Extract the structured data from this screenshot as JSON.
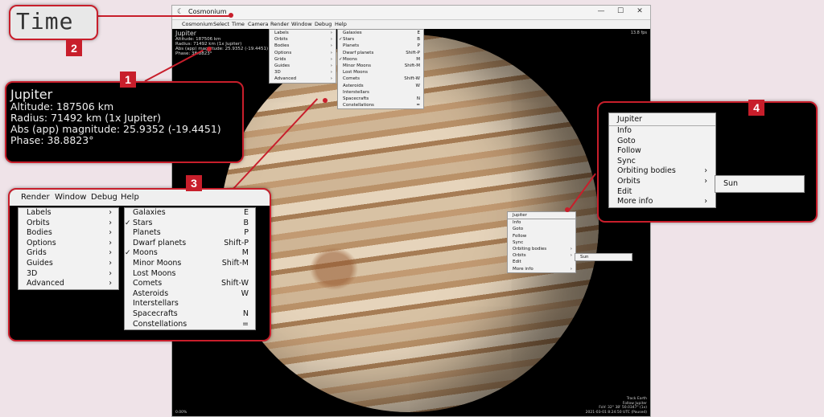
{
  "window": {
    "title": "Cosmonium",
    "app_icon": "moon-icon",
    "controls": {
      "minimize": "—",
      "maximize": "☐",
      "close": "✕"
    }
  },
  "menubar": [
    "Cosmonium",
    "Select",
    "Time",
    "Camera",
    "Render",
    "Window",
    "Debug",
    "Help"
  ],
  "hud": {
    "name": "Jupiter",
    "altitude": "Altitude: 187506 km",
    "radius": "Radius: 71492 km (1x Jupiter)",
    "magnitude": "Abs (app) magnitude: 25.9352 (-19.4451)",
    "phase": "Phase: 38.8823°",
    "fps": "13.8 fps",
    "bottom_left": "0.00%",
    "bottom_right": [
      "Track Earth",
      "Follow Jupiter",
      "FoV: 32° 38' 50.0347\" (1x)",
      "2021-03-01 8:24:50 UTC (Paused)"
    ]
  },
  "render_menu": {
    "items": [
      {
        "label": "Labels",
        "arrow": "›"
      },
      {
        "label": "Orbits",
        "arrow": "›"
      },
      {
        "label": "Bodies",
        "arrow": "›"
      },
      {
        "label": "Options",
        "arrow": "›"
      },
      {
        "label": "Grids",
        "arrow": "›"
      },
      {
        "label": "Guides",
        "arrow": "›"
      },
      {
        "label": "3D",
        "arrow": "›"
      },
      {
        "label": "Advanced",
        "arrow": "›"
      }
    ]
  },
  "labels_submenu": {
    "items": [
      {
        "label": "Galaxies",
        "key": "E",
        "check": ""
      },
      {
        "label": "Stars",
        "key": "B",
        "check": "✓"
      },
      {
        "label": "Planets",
        "key": "P",
        "check": ""
      },
      {
        "label": "Dwarf planets",
        "key": "Shift-P",
        "check": ""
      },
      {
        "label": "Moons",
        "key": "M",
        "check": "✓"
      },
      {
        "label": "Minor Moons",
        "key": "Shift-M",
        "check": ""
      },
      {
        "label": "Lost Moons",
        "key": "",
        "check": ""
      },
      {
        "label": "Comets",
        "key": "Shift-W",
        "check": ""
      },
      {
        "label": "Asteroids",
        "key": "W",
        "check": ""
      },
      {
        "label": "Interstellars",
        "key": "",
        "check": ""
      },
      {
        "label": "Spacecrafts",
        "key": "N",
        "check": ""
      },
      {
        "label": "Constellations",
        "key": "=",
        "check": ""
      }
    ]
  },
  "context_menu": {
    "header": "Jupiter",
    "items": [
      {
        "label": "Info",
        "arrow": ""
      },
      {
        "label": "Goto",
        "arrow": ""
      },
      {
        "label": "Follow",
        "arrow": ""
      },
      {
        "label": "Sync",
        "arrow": ""
      },
      {
        "label": "Orbiting bodies",
        "arrow": "›"
      },
      {
        "label": "Orbits",
        "arrow": "›"
      },
      {
        "label": "Edit",
        "arrow": ""
      },
      {
        "label": "More info",
        "arrow": "›"
      }
    ],
    "orbits_submenu": [
      "Sun"
    ]
  },
  "callouts": {
    "time_label": "Time",
    "badges": [
      "1",
      "2",
      "3",
      "4"
    ]
  },
  "colors": {
    "accent": "#c81e2b",
    "background": "#efe3e8"
  }
}
